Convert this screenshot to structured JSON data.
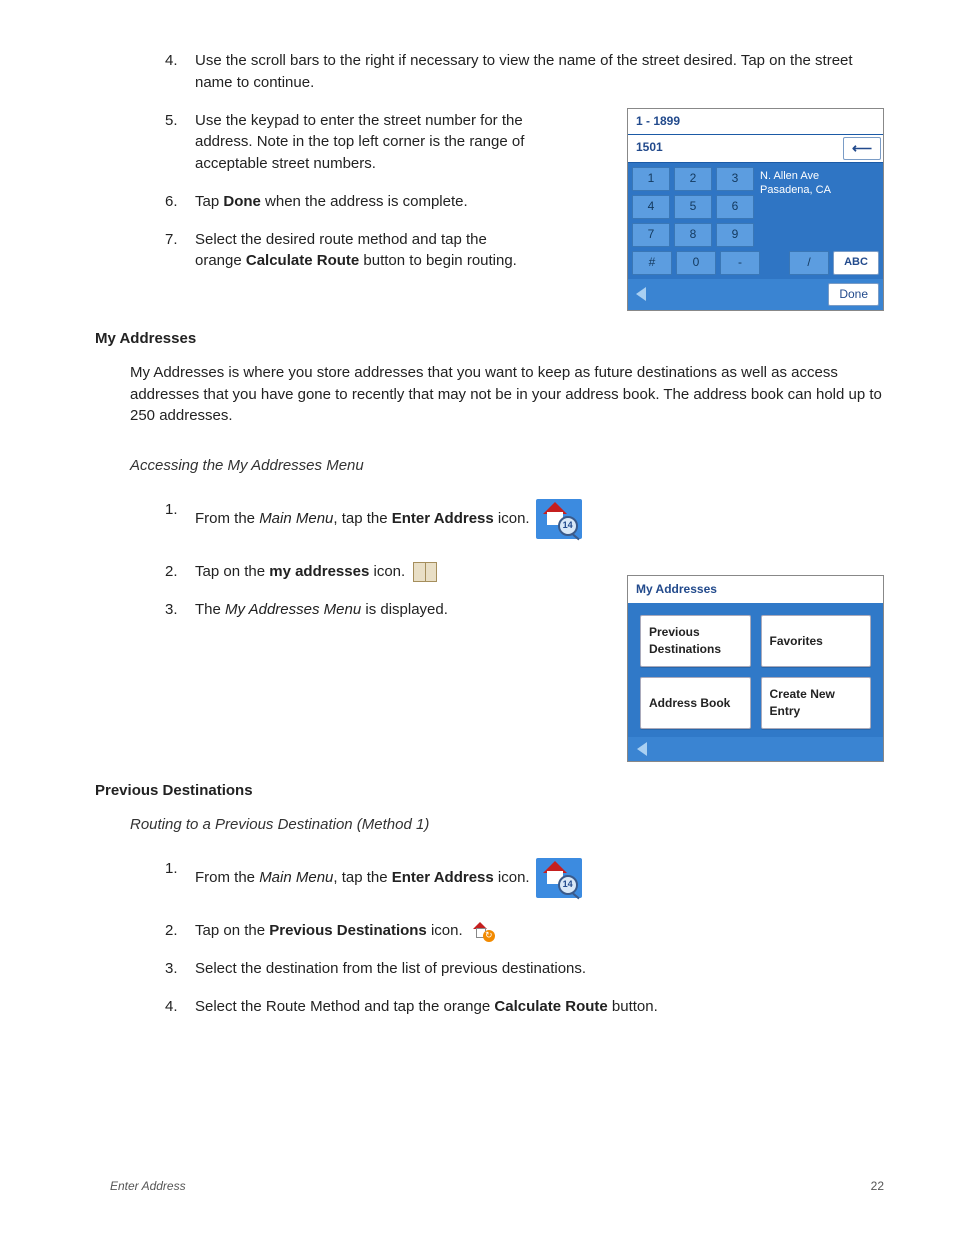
{
  "topSteps": [
    {
      "n": "4.",
      "t_a": "Use the scroll bars to the right if necessary to view the name of the street desired.  Tap on the street name to continue."
    },
    {
      "n": "5.",
      "t_a": "Use the keypad to enter the street number for the address.  Note in the top left corner is the range of acceptable street numbers."
    },
    {
      "n": "6.",
      "t_a": "Tap ",
      "bold1": "Done",
      "t_b": " when the address is complete."
    },
    {
      "n": "7.",
      "t_a": "Select the desired route method and tap the orange ",
      "bold1": "Calculate Route",
      "t_b": " button to begin routing."
    }
  ],
  "sect1": "My Addresses",
  "intro1": "My Addresses is where you store addresses that you want to keep as future destinations as well as access addresses that you have gone to recently that may not be in your address book.  The address book can hold up to 250 addresses.",
  "sub1": "Accessing the My Addresses Menu",
  "midSteps": [
    {
      "n": "1.",
      "a": "From the ",
      "it": "Main Menu",
      "b": ", tap the ",
      "bold": "Enter Address",
      "c": " icon."
    },
    {
      "n": "2.",
      "a": "Tap on the ",
      "bold": "my addresses",
      "c": " icon."
    },
    {
      "n": "3.",
      "a": "The ",
      "it": "My Addresses Menu",
      "c": " is displayed."
    }
  ],
  "sect2": "Previous Destinations",
  "sub2": "Routing to a Previous Destination (Method 1)",
  "botSteps": [
    {
      "n": "1.",
      "a": "From the ",
      "it": "Main Menu",
      "b": ", tap the ",
      "bold": "Enter Address",
      "c": " icon."
    },
    {
      "n": "2.",
      "a": "Tap on the ",
      "bold": "Previous Destinations",
      "c": " icon."
    },
    {
      "n": "3.",
      "a": "Select the destination from the list of previous destinations."
    },
    {
      "n": "4.",
      "a": "Select the Route Method and tap the orange ",
      "bold": "Calculate Route",
      "c": " button."
    }
  ],
  "keypad": {
    "range": "1 - 1899",
    "value": "1501",
    "keys": [
      "1",
      "2",
      "3",
      "4",
      "5",
      "6",
      "7",
      "8",
      "9",
      "#",
      "0",
      "-",
      "/"
    ],
    "side1": "N. Allen Ave",
    "side2": "Pasadena, CA",
    "abc": "ABC",
    "done": "Done",
    "back": "⟵"
  },
  "maPanel": {
    "title": "My Addresses",
    "buttons": [
      "Previous Destinations",
      "Favorites",
      "Address Book",
      "Create New Entry"
    ]
  },
  "addrBadge": "14",
  "footerL": "Enter Address",
  "footerR": "22"
}
